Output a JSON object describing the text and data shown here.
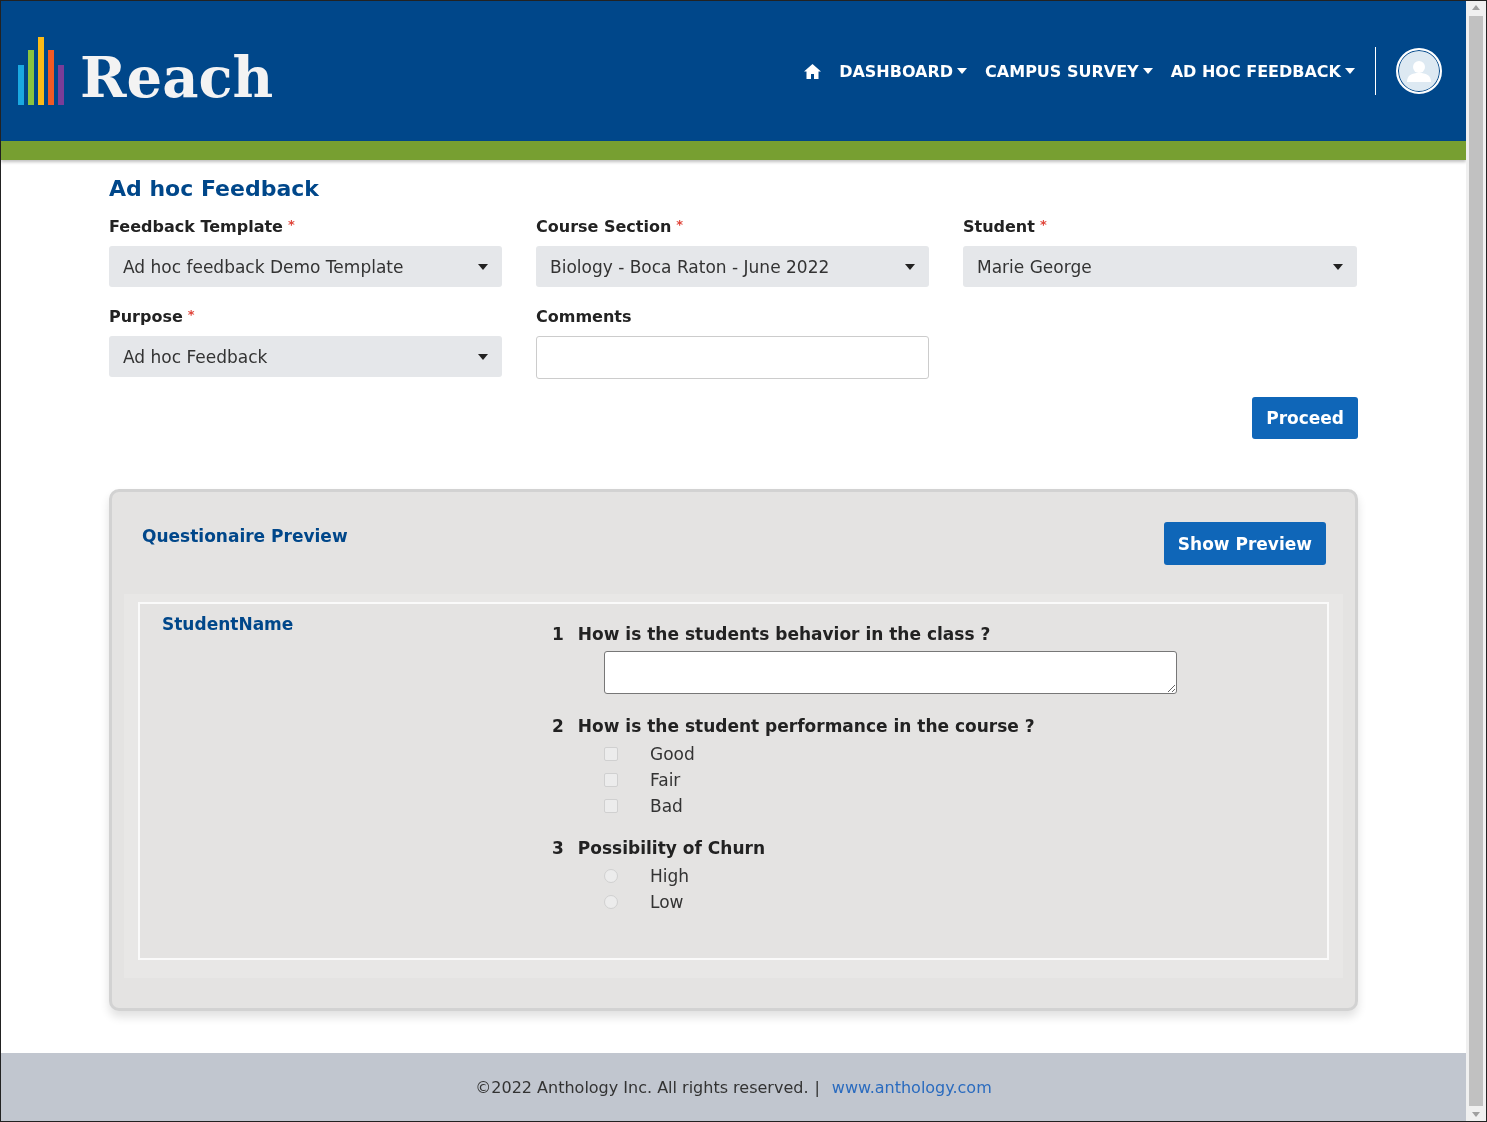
{
  "header": {
    "logo": "Reach",
    "nav": [
      {
        "label": "DASHBOARD",
        "has_menu": true
      },
      {
        "label": "CAMPUS SURVEY",
        "has_menu": true
      },
      {
        "label": "AD HOC FEEDBACK",
        "has_menu": true
      }
    ]
  },
  "page_title": "Ad hoc Feedback",
  "fields": [
    {
      "label": "Feedback Template",
      "required_mark": "*",
      "kind": "select",
      "value": "Ad hoc feedback Demo Template"
    },
    {
      "label": "Course Section",
      "required_mark": "*",
      "kind": "select",
      "value": "Biology - Boca Raton - June 2022"
    },
    {
      "label": "Student",
      "required_mark": "*",
      "kind": "select",
      "value": "Marie George"
    },
    {
      "label": "Purpose",
      "required_mark": "*",
      "kind": "select",
      "value": "Ad hoc Feedback"
    },
    {
      "label": "Comments",
      "kind": "text"
    }
  ],
  "proceed_button": "Proceed",
  "preview": {
    "title": "Questionaire Preview",
    "button": "Show Preview",
    "student_label": "StudentName",
    "questions": [
      {
        "number": "1",
        "text": "How is the students behavior in the class ?",
        "kind": "text"
      },
      {
        "number": "2",
        "text": "How is the student performance in the course ?",
        "kind": "checkbox",
        "options": [
          {
            "label": "Good",
            "checked": false
          },
          {
            "label": "Fair",
            "checked": false
          },
          {
            "label": "Bad",
            "checked": false
          }
        ]
      },
      {
        "number": "3",
        "text": "Possibility of Churn",
        "kind": "radio",
        "options": [
          {
            "label": "High",
            "checked": false
          },
          {
            "label": "Low",
            "checked": false
          }
        ]
      }
    ]
  },
  "footer": {
    "copyright": "©2022 Anthology Inc. All rights reserved.",
    "separator": "|",
    "link": "www.anthology.com"
  }
}
